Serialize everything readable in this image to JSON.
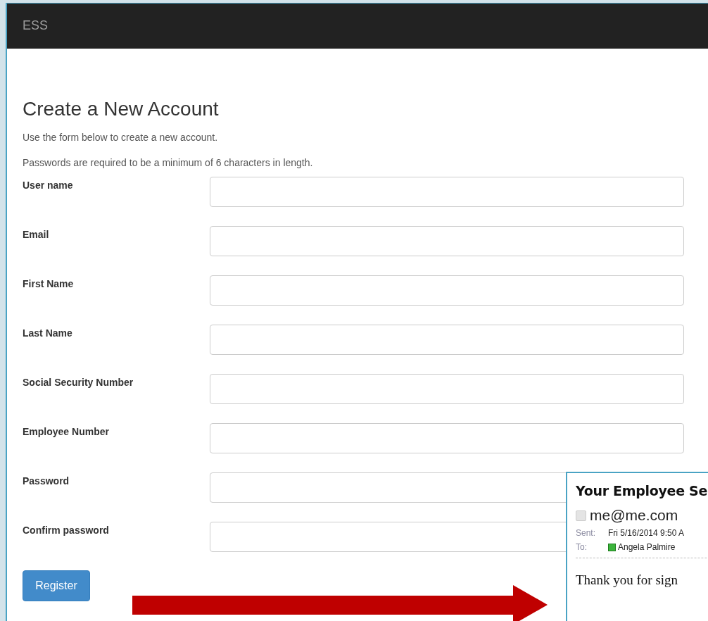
{
  "header": {
    "brand": "ESS"
  },
  "page": {
    "title": "Create a New Account",
    "intro": "Use the form below to create a new account.",
    "password_note": "Passwords are required to be a minimum of 6 characters in length."
  },
  "fields": [
    {
      "label": "User name"
    },
    {
      "label": "Email"
    },
    {
      "label": "First Name"
    },
    {
      "label": "Last Name"
    },
    {
      "label": "Social Security Number"
    },
    {
      "label": "Employee Number"
    },
    {
      "label": "Password"
    },
    {
      "label": "Confirm password"
    }
  ],
  "submit": {
    "label": "Register"
  },
  "email_preview": {
    "subject": "Your Employee Se",
    "sender": "me@me.com",
    "sent_label": "Sent:",
    "sent_value": "Fri 5/16/2014 9:50 A",
    "to_label": "To:",
    "to_value": "Angela Palmire",
    "body": "Thank you for sign"
  }
}
